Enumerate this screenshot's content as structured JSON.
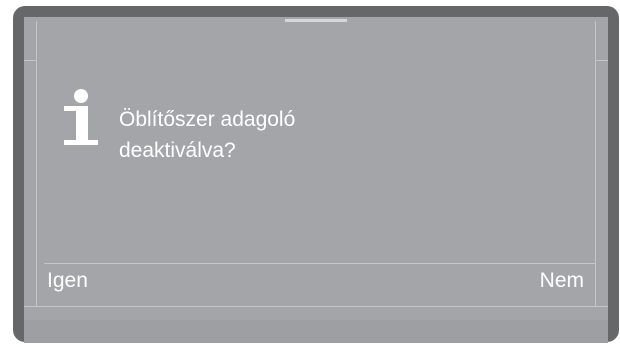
{
  "dialog": {
    "icon": "info-icon",
    "message": "Öblítőszer adagoló\ndeaktiválva?"
  },
  "softkeys": {
    "left_label": "Igen",
    "right_label": "Nem"
  },
  "colors": {
    "bezel": "#666769",
    "screen": "#a4a5a8",
    "text": "#ffffff",
    "guide": "#c4c5c7"
  }
}
